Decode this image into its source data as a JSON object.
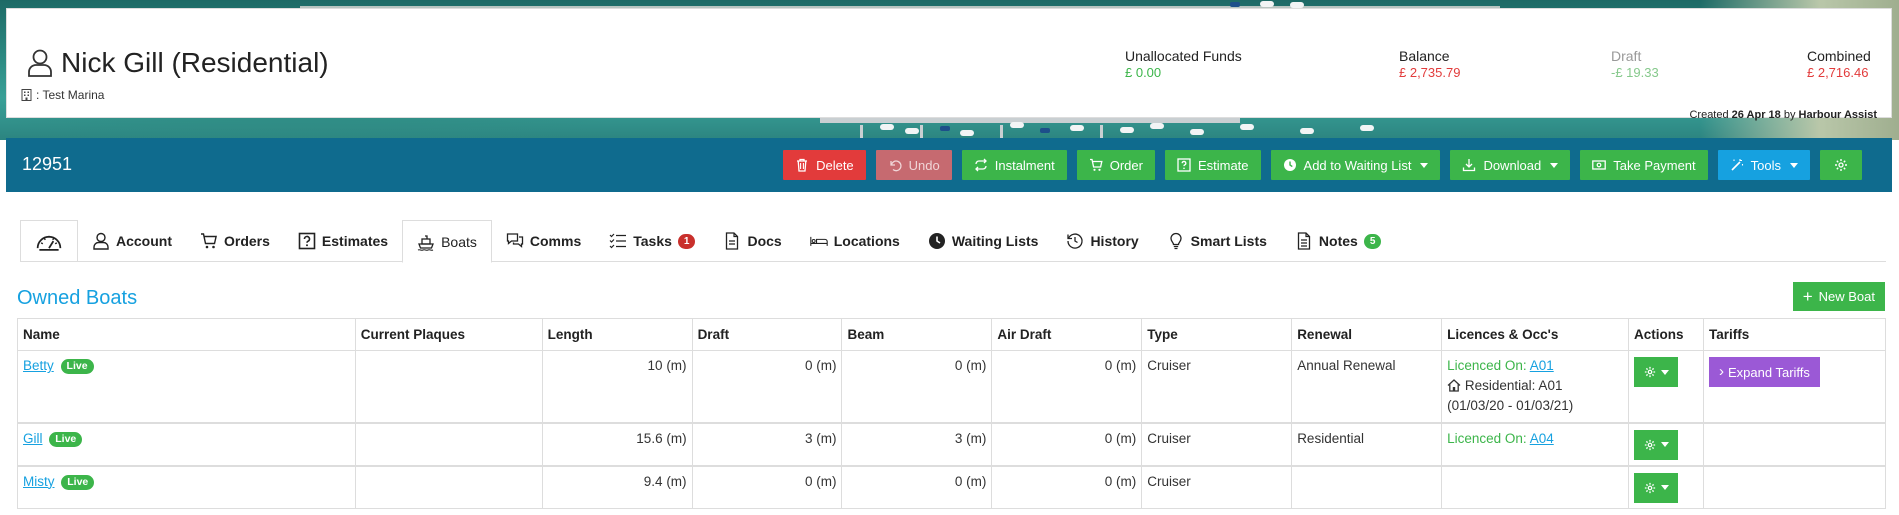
{
  "colors": {
    "accent": "#16a1e0",
    "green": "#3cb54a",
    "red": "#e23b3b",
    "band": "#0f6b8e",
    "purple": "#9b59d6"
  },
  "header": {
    "name": "Nick Gill (Residential)",
    "marina": ": Test Marina",
    "stats": {
      "unallocated_label": "Unallocated Funds",
      "unallocated_value": "£ 0.00",
      "balance_label": "Balance",
      "balance_value": "£ 2,735.79",
      "draft_label": "Draft",
      "draft_value": "-£ 19.33",
      "combined_label": "Combined",
      "combined_value": "£ 2,716.46"
    },
    "created_prefix": "Created",
    "created_date": "26 Apr 18",
    "created_by_prefix": "by",
    "created_by": "Harbour Assist"
  },
  "band": {
    "account_number": "12951",
    "buttons": {
      "delete": "Delete",
      "undo": "Undo",
      "instalment": "Instalment",
      "order": "Order",
      "estimate": "Estimate",
      "waiting_list": "Add to Waiting List",
      "download": "Download",
      "take_payment": "Take Payment",
      "tools": "Tools"
    }
  },
  "tabs": {
    "account": "Account",
    "orders": "Orders",
    "estimates": "Estimates",
    "boats": "Boats",
    "comms": "Comms",
    "tasks": "Tasks",
    "tasks_badge": "1",
    "docs": "Docs",
    "locations": "Locations",
    "waiting_lists": "Waiting Lists",
    "history": "History",
    "smart_lists": "Smart Lists",
    "notes": "Notes",
    "notes_badge": "5"
  },
  "boats": {
    "title": "Owned Boats",
    "new_boat": "New Boat",
    "columns": [
      "Name",
      "Current Plaques",
      "Length",
      "Draft",
      "Beam",
      "Air Draft",
      "Type",
      "Renewal",
      "Licences & Occ's",
      "Actions",
      "Tariffs"
    ],
    "live_label": "Live",
    "expand_tariffs": "Expand Tariffs",
    "rows": [
      {
        "name": "Betty",
        "plaques": "",
        "length": "10 (m)",
        "draft": "0 (m)",
        "beam": "0 (m)",
        "air_draft": "0 (m)",
        "type": "Cruiser",
        "renewal": "Annual Renewal",
        "licence_prefix": "Licenced On:",
        "licence_code": "A01",
        "occupancy": "Residential: A01",
        "occupancy_dates": "(01/03/20 - 01/03/21)"
      },
      {
        "name": "Gill",
        "plaques": "",
        "length": "15.6 (m)",
        "draft": "3 (m)",
        "beam": "3 (m)",
        "air_draft": "0 (m)",
        "type": "Cruiser",
        "renewal": "Residential",
        "licence_prefix": "Licenced On:",
        "licence_code": "A04"
      },
      {
        "name": "Misty",
        "plaques": "",
        "length": "9.4 (m)",
        "draft": "0 (m)",
        "beam": "0 (m)",
        "air_draft": "0 (m)",
        "type": "Cruiser",
        "renewal": ""
      }
    ]
  }
}
